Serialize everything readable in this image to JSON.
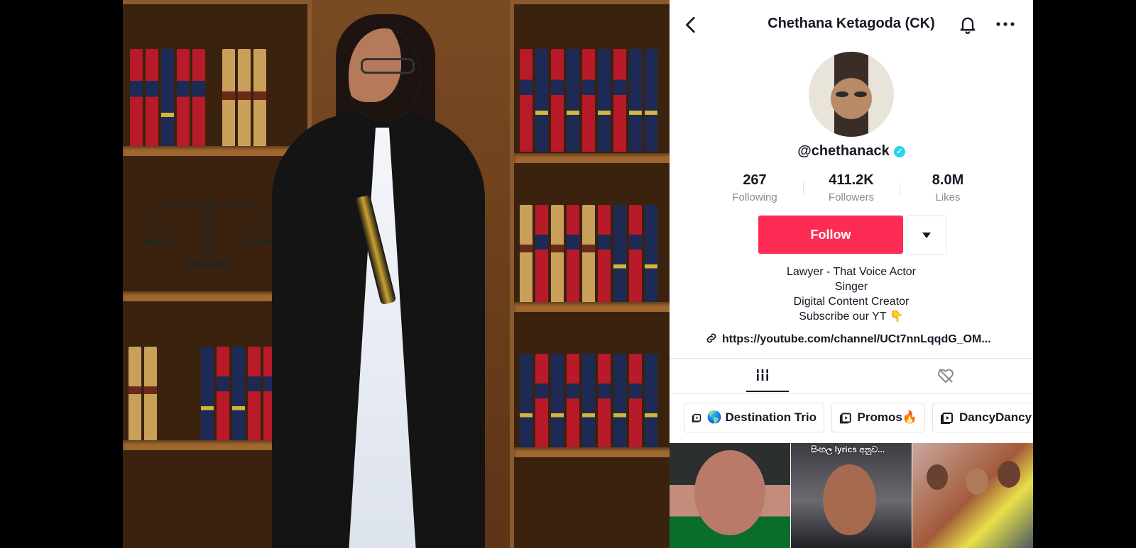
{
  "header": {
    "title": "Chethana Ketagoda (CK)",
    "back_icon": "chevron-left-icon",
    "bell_icon": "bell-icon",
    "more_icon": "more-horizontal-icon"
  },
  "profile": {
    "username": "@chethanack",
    "verified": true,
    "stats": [
      {
        "value": "267",
        "label": "Following"
      },
      {
        "value": "411.2K",
        "label": "Followers"
      },
      {
        "value": "8.0M",
        "label": "Likes"
      }
    ],
    "follow_label": "Follow",
    "bio": [
      "Lawyer - That Voice Actor",
      "Singer",
      "Digital Content Creator",
      "Subscribe our YT 👇"
    ],
    "link": "https://youtube.com/channel/UCt7nnLqqdG_OM..."
  },
  "tabs": [
    {
      "name": "videos",
      "icon": "grid-bars-icon",
      "active": true
    },
    {
      "name": "liked",
      "icon": "hidden-heart-icon",
      "active": false
    }
  ],
  "playlists": [
    "🌎 Destination Trio",
    "Promos🔥",
    "DancyDancy"
  ],
  "thumbnails": [
    {
      "caption": ""
    },
    {
      "caption": "සිංහල lyrics අනුව..."
    },
    {
      "caption": ""
    }
  ],
  "colors": {
    "accent": "#fe2c55",
    "verified": "#20d5ec",
    "text": "#161823",
    "muted": "#8a8b91"
  }
}
